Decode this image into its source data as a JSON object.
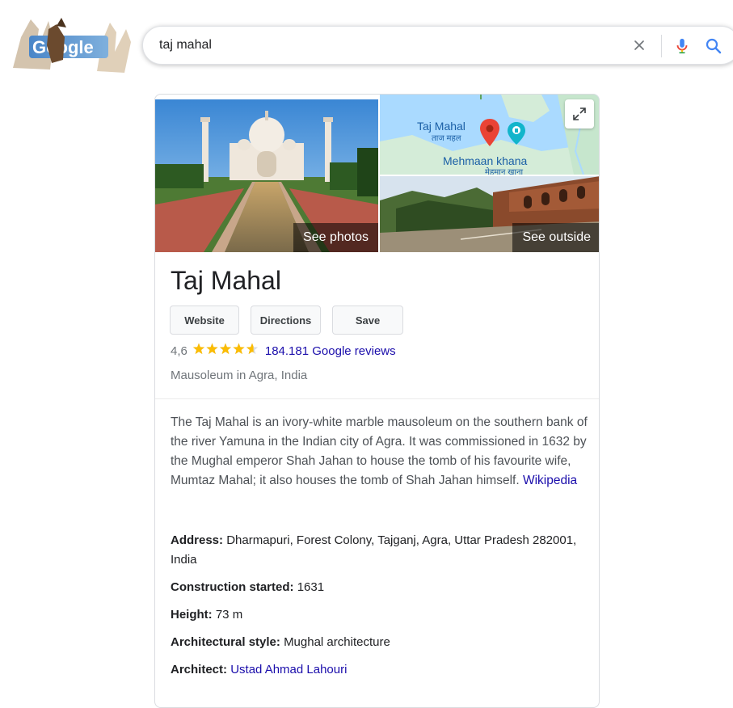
{
  "search": {
    "query": "taj mahal",
    "clear_icon": "close-icon",
    "mic_icon": "microphone-icon",
    "search_icon": "magnifier-icon"
  },
  "doodle": {
    "text": "Google",
    "colors": {
      "blue": "#4285f4",
      "red": "#ea4335",
      "yellow": "#fbbc05",
      "green": "#34a853"
    }
  },
  "panel": {
    "see_photos": "See photos",
    "see_outside": "See outside",
    "map": {
      "label_main": "Taj Mahal",
      "label_main_sub": "ताज महल",
      "label_nearby": "Mehmaan khana",
      "label_nearby_sub": "मेहमान खाना",
      "expand_icon": "expand-icon"
    },
    "title": "Taj Mahal",
    "buttons": [
      "Website",
      "Directions",
      "Save"
    ],
    "rating": "4,6",
    "stars_filled": 4.6,
    "reviews": "184.181 Google reviews",
    "subtitle": "Mausoleum in Agra, India",
    "description": "The Taj Mahal is an ivory-white marble mausoleum on the southern bank of the river Yamuna in the Indian city of Agra. It was commissioned in 1632 by the Mughal emperor Shah Jahan to house the tomb of his favourite wife, Mumtaz Mahal; it also houses the tomb of Shah Jahan himself.",
    "description_link": "Wikipedia",
    "facts": [
      {
        "key": "Address:",
        "value": "Dharmapuri, Forest Colony, Tajganj, Agra, Uttar Pradesh 282001, India"
      },
      {
        "key": "Construction started:",
        "value": "1631"
      },
      {
        "key": "Height:",
        "value": "73 m"
      },
      {
        "key": "Architectural style:",
        "value": "Mughal architecture"
      },
      {
        "key": "Architect:",
        "value": "Ustad Ahmad Lahouri"
      }
    ],
    "colors": {
      "link": "#1a0dab",
      "star": "#fbbc04",
      "pin": "#ea4335",
      "map_land": "#d4ecd8",
      "map_water": "#aadaff"
    }
  }
}
